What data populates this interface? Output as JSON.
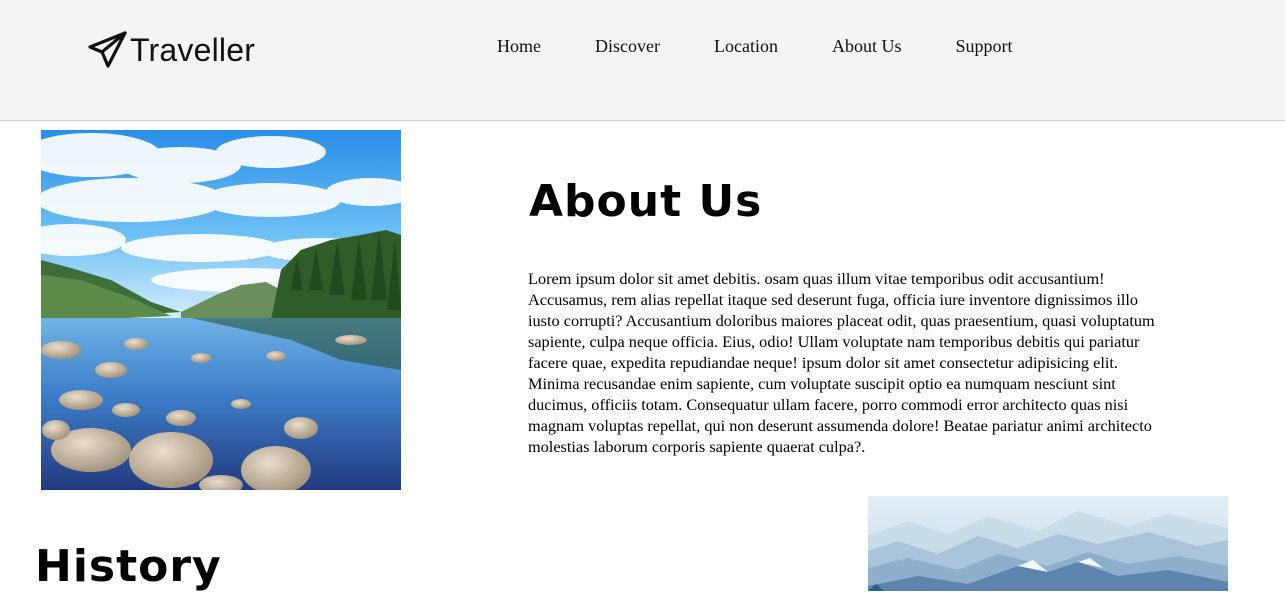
{
  "brand": {
    "name": "Traveller",
    "icon": "paper-plane-icon"
  },
  "nav": {
    "items": [
      {
        "label": "Home"
      },
      {
        "label": "Discover"
      },
      {
        "label": "Location"
      },
      {
        "label": "About Us"
      },
      {
        "label": "Support"
      }
    ]
  },
  "about": {
    "title": "About Us",
    "body": "Lorem ipsum dolor sit amet debitis. osam quas illum vitae temporibus odit accusantium! Accusamus, rem alias repellat itaque sed deserunt fuga, officia iure inventore dignissimos illo iusto corrupti? Accusantium doloribus maiores placeat odit, quas praesentium, quasi voluptatum sapiente, culpa neque officia. Eius, odio! Ullam voluptate nam temporibus debitis qui pariatur facere quae, expedita repudiandae neque! ipsum dolor sit amet consectetur adipisicing elit. Minima recusandae enim sapiente, cum voluptate suscipit optio ea numquam nesciunt sint ducimus, officiis totam. Consequatur ullam facere, porro commodi error architecto quas nisi magnam voluptas repellat, qui non deserunt assumenda dolore! Beatae pariatur animi architecto molestias laborum corporis sapiente quaerat culpa?."
  },
  "history": {
    "title": "History"
  },
  "images": {
    "lake": "lake-landscape-photo",
    "mountains": "misty-mountains-photo"
  },
  "colors": {
    "header_bg": "#f4f4f4",
    "text": "#000000"
  }
}
